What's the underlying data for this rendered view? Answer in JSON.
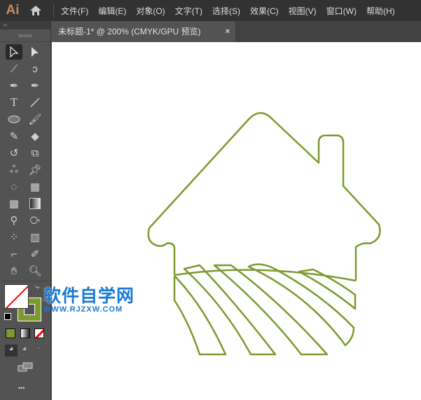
{
  "app": {
    "logo": "Ai"
  },
  "menu": [
    "文件(F)",
    "编辑(E)",
    "对象(O)",
    "文字(T)",
    "选择(S)",
    "效果(C)",
    "视图(V)",
    "窗口(W)",
    "帮助(H)"
  ],
  "document_tab": {
    "title": "未标题-1* @ 200% (CMYK/GPU 预览)",
    "close": "×"
  },
  "toolbar": {
    "collapse": "‹‹",
    "more": "•••"
  },
  "watermark": {
    "line1": "软件自学网",
    "line2": "WWW.RJZXW.COM"
  },
  "colors": {
    "stroke": "#7d9a2f",
    "accent": "#1a7ad4"
  }
}
